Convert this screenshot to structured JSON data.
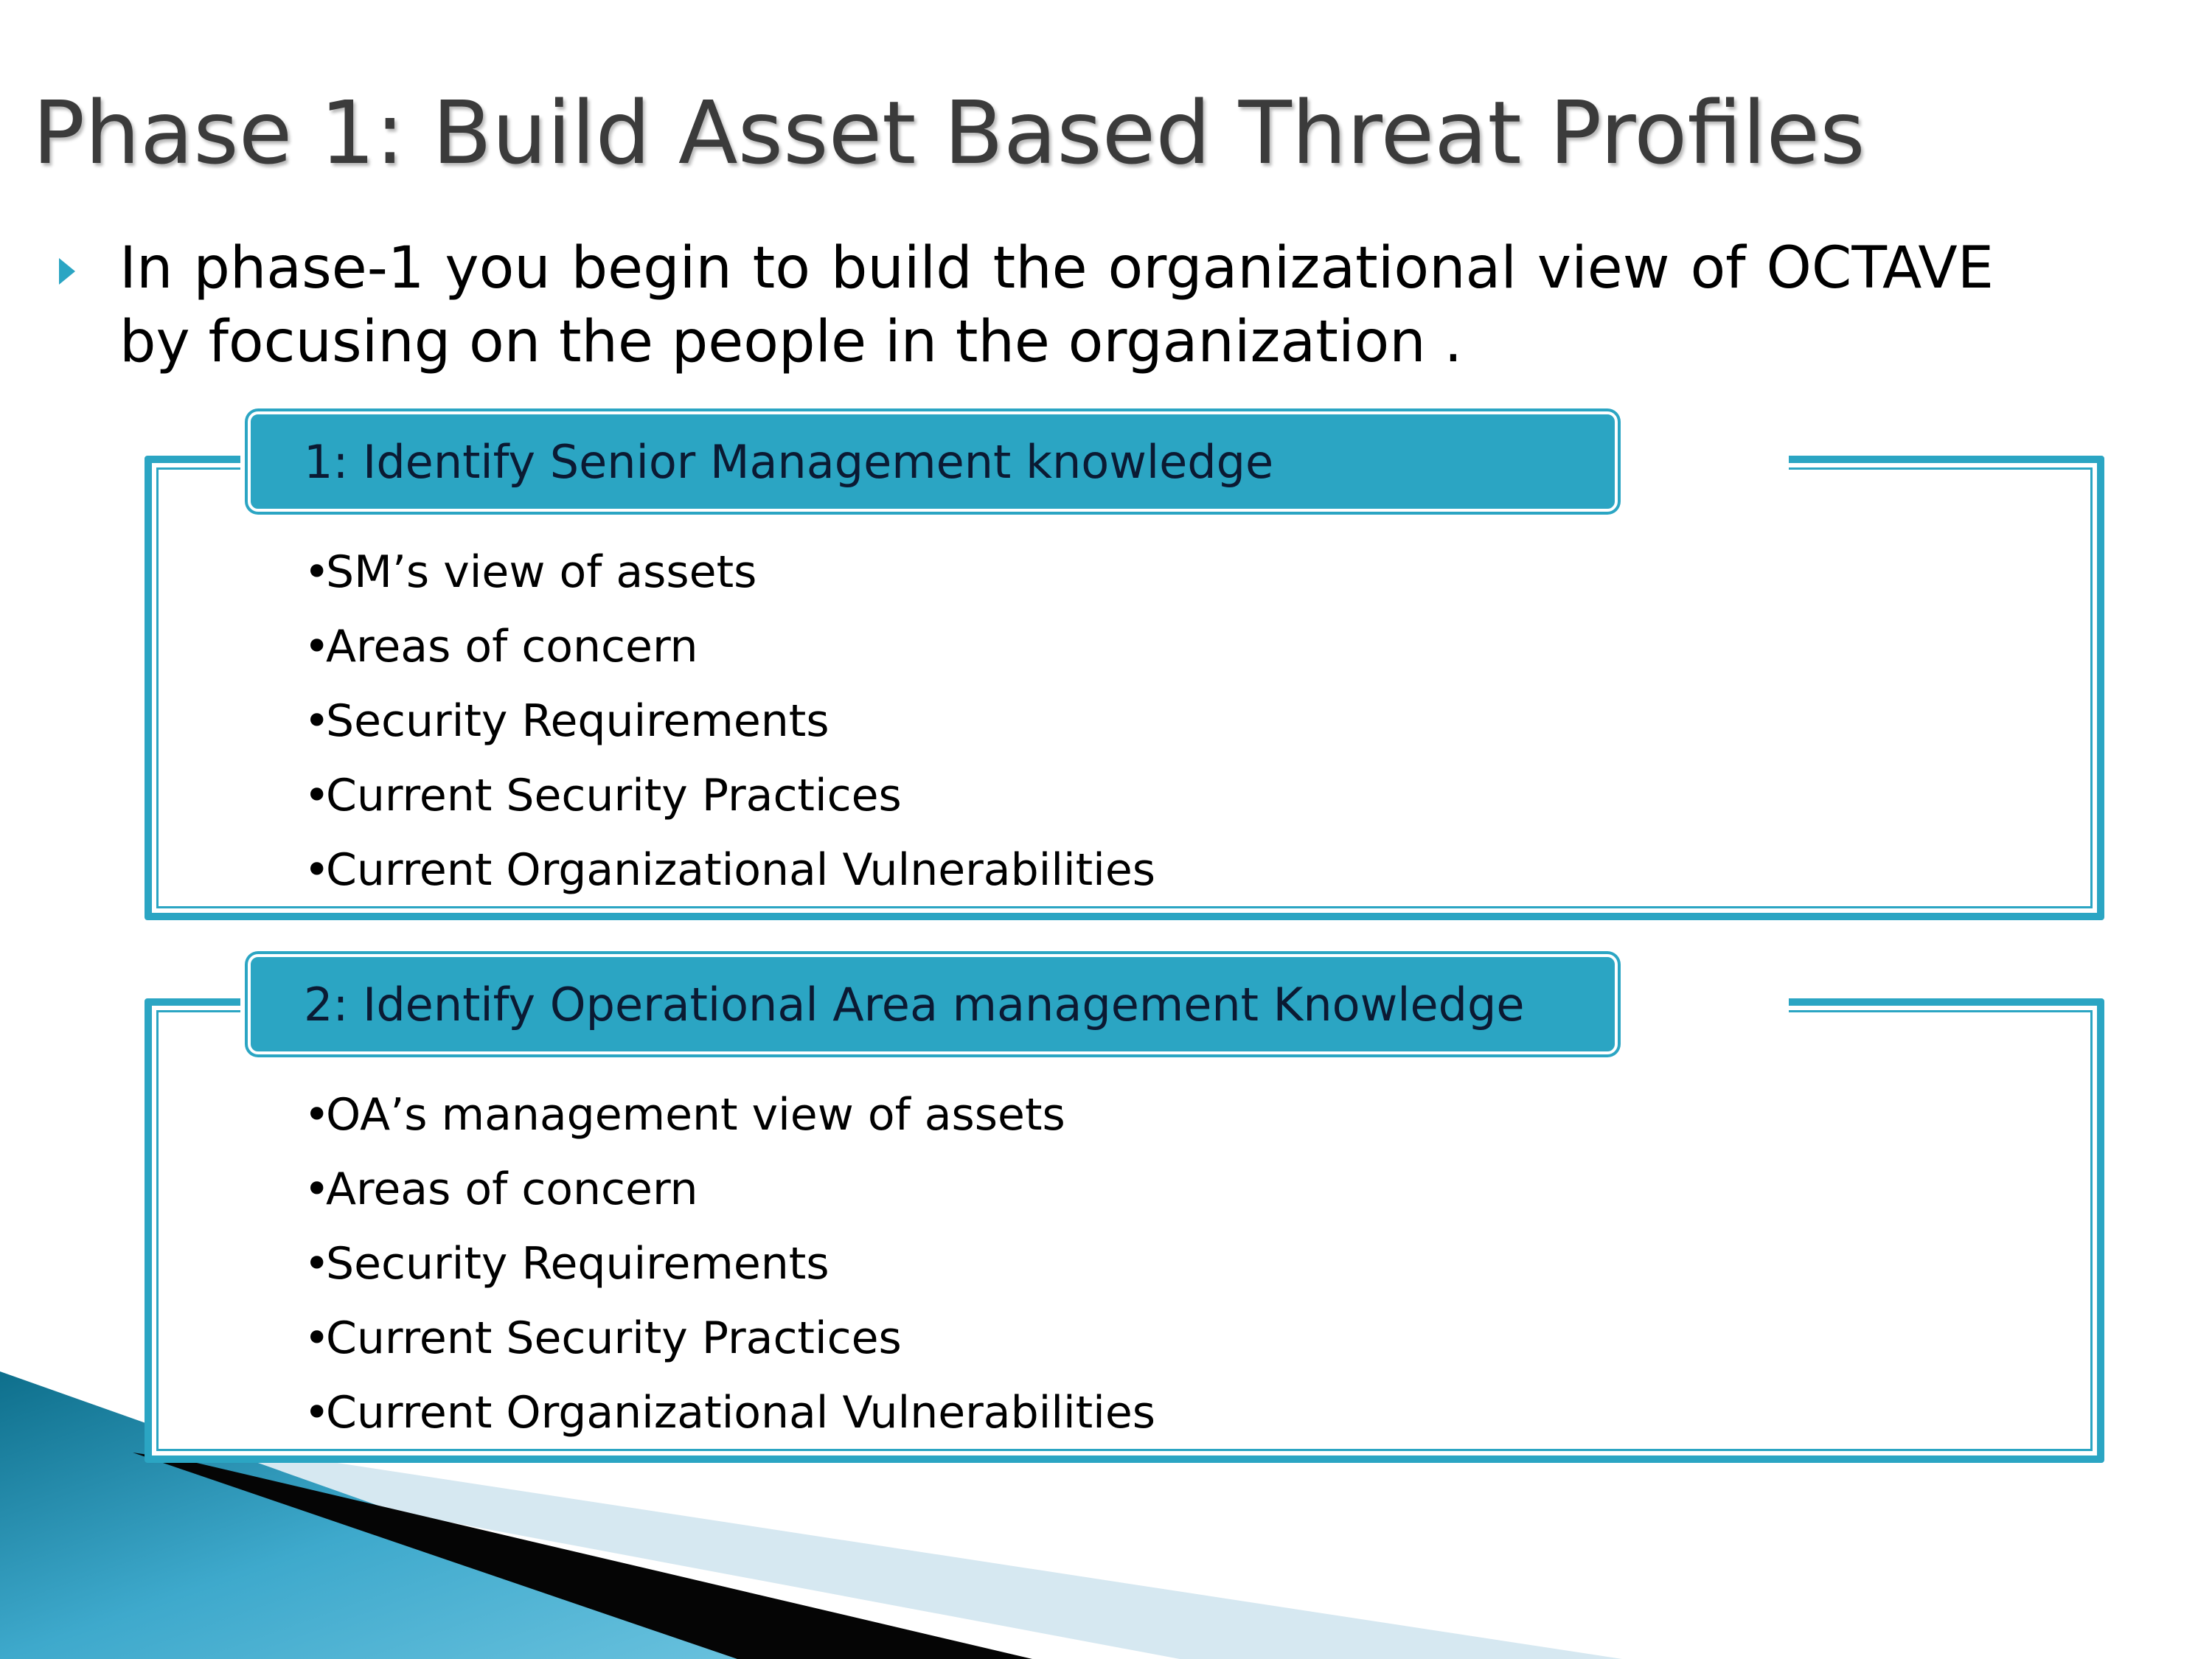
{
  "title": "Phase 1: Build Asset Based Threat Profiles",
  "intro": {
    "marker_icon": "triangle-bullet-icon",
    "text": "In phase-1 you begin to build the organizational view of OCTAVE by focusing on the people in the organization ."
  },
  "sections": [
    {
      "header": "1: Identify Senior Management knowledge",
      "items": [
        "SM’s view of assets",
        "Areas of concern",
        "Security Requirements",
        "Current Security Practices",
        "Current Organizational Vulnerabilities"
      ]
    },
    {
      "header": "2: Identify Operational Area management Knowledge",
      "items": [
        "OA’s management view of assets",
        "Areas of concern",
        "Security Requirements",
        "Current Security Practices",
        "Current Organizational Vulnerabilities"
      ]
    }
  ],
  "colors": {
    "accent": "#2ba5c3",
    "title_text": "#3b3b3b",
    "header_text": "#0b1a33",
    "body_text": "#000000"
  }
}
